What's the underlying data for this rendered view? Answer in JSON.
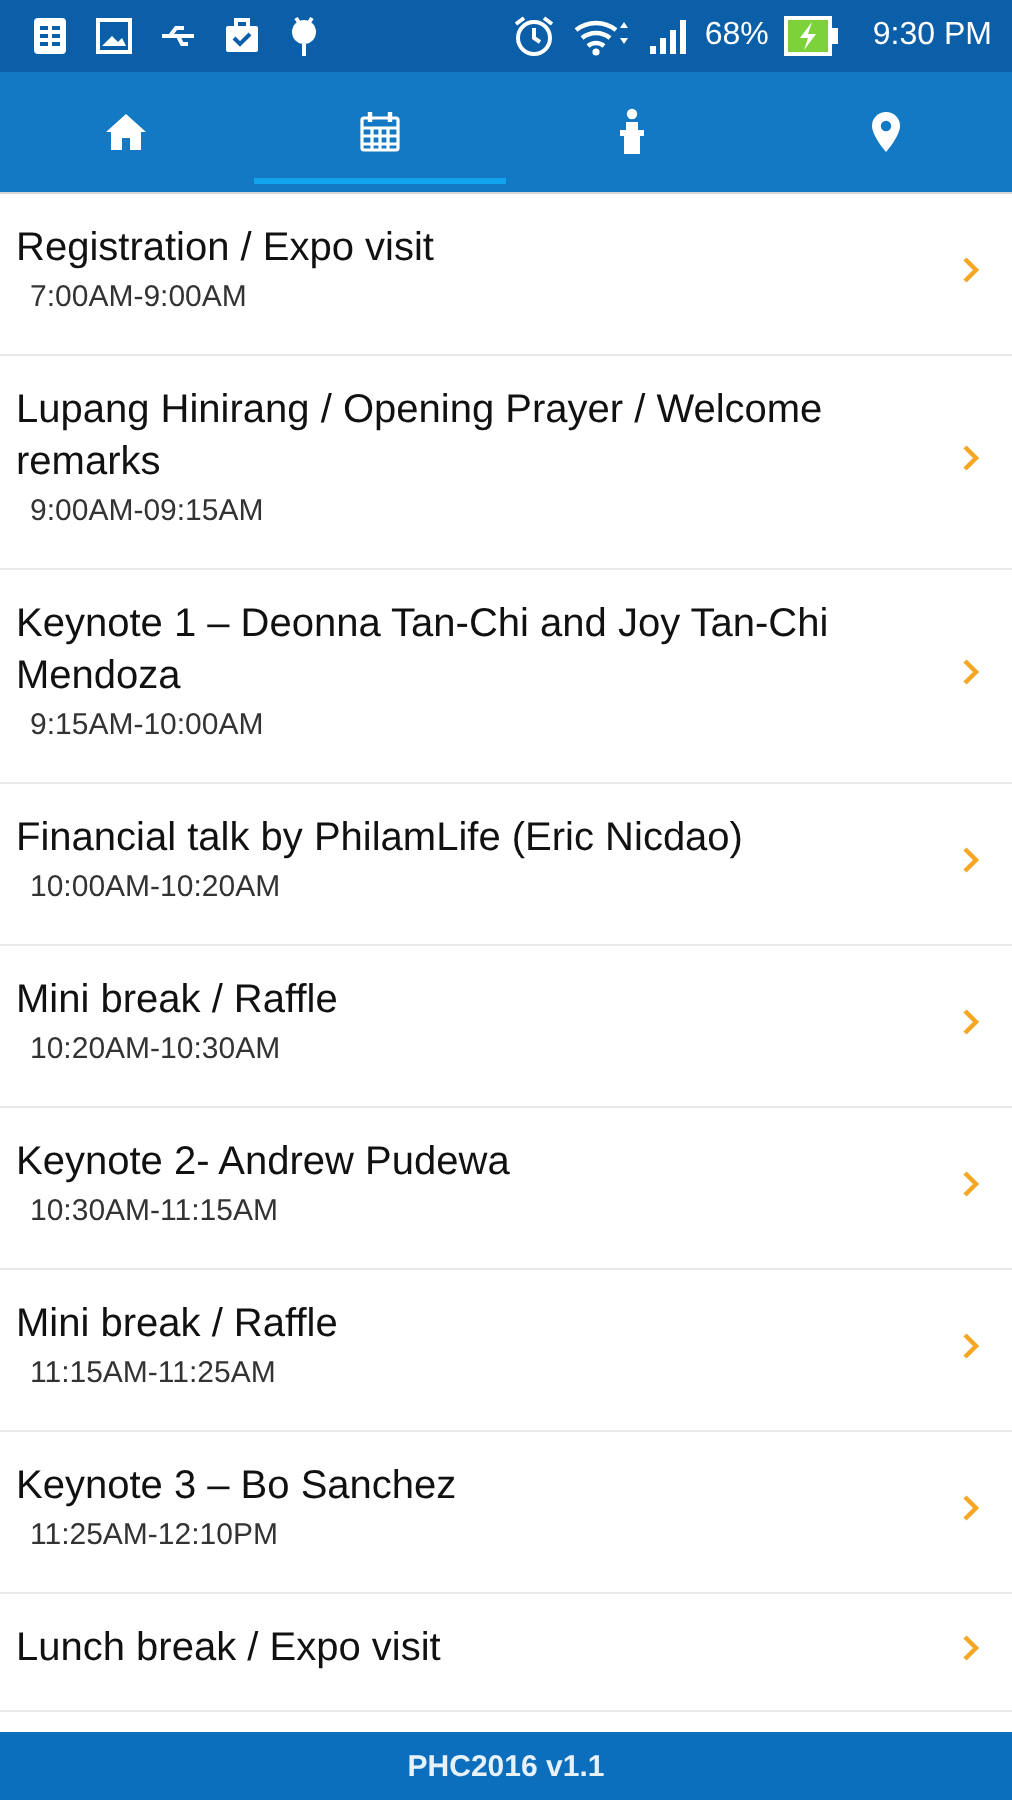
{
  "status_bar": {
    "battery": "68%",
    "time": "9:30 PM"
  },
  "tabs": [
    {
      "kind": "home",
      "selected": false
    },
    {
      "kind": "calendar",
      "selected": true
    },
    {
      "kind": "speaker",
      "selected": false
    },
    {
      "kind": "location",
      "selected": false
    }
  ],
  "schedule": [
    {
      "title": "Registration / Expo visit",
      "time": "7:00AM-9:00AM"
    },
    {
      "title": "Lupang Hinirang / Opening Prayer / Welcome remarks",
      "time": "9:00AM-09:15AM"
    },
    {
      "title": "Keynote 1 – Deonna Tan-Chi and Joy Tan-Chi Mendoza",
      "time": "9:15AM-10:00AM"
    },
    {
      "title": "Financial talk by PhilamLife (Eric Nicdao)",
      "time": "10:00AM-10:20AM"
    },
    {
      "title": "Mini break / Raffle",
      "time": "10:20AM-10:30AM"
    },
    {
      "title": "Keynote 2- Andrew Pudewa",
      "time": "10:30AM-11:15AM"
    },
    {
      "title": "Mini break / Raffle",
      "time": "11:15AM-11:25AM"
    },
    {
      "title": "Keynote 3 – Bo Sanchez",
      "time": "11:25AM-12:10PM"
    },
    {
      "title": "Lunch break / Expo visit"
    }
  ],
  "footer": "PHC2016 v1.1"
}
